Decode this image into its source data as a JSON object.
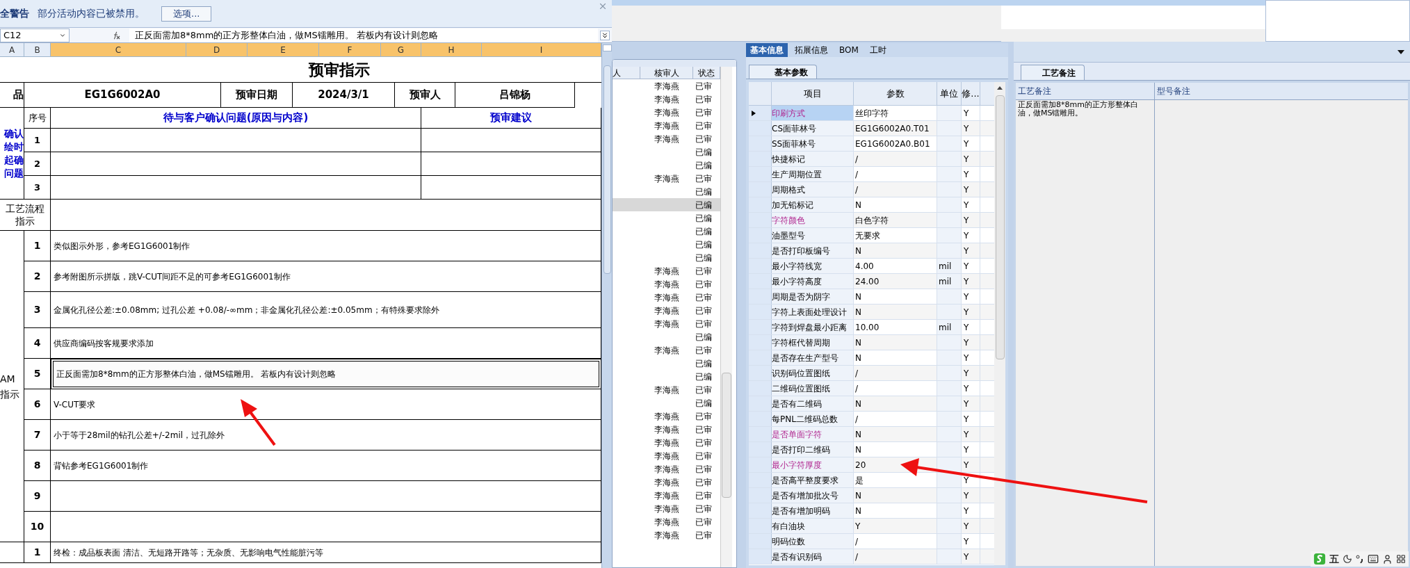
{
  "alert_bar": {
    "title": "全警告",
    "message": "部分活动内容已被禁用。",
    "button": "选项..."
  },
  "formula_bar": {
    "cell": "C12",
    "formula": "正反面需加8*8mm的正方形整体白油，做MS镭雕用。 若板内有设计则忽略"
  },
  "column_headers": [
    {
      "label": "A",
      "selected": false
    },
    {
      "label": "B",
      "selected": false
    },
    {
      "label": "C",
      "selected": true
    },
    {
      "label": "D",
      "selected": true
    },
    {
      "label": "E",
      "selected": true
    },
    {
      "label": "F",
      "selected": true
    },
    {
      "label": "G",
      "selected": true
    },
    {
      "label": "H",
      "selected": true
    },
    {
      "label": "I",
      "selected": true
    }
  ],
  "sheet": {
    "title": "预审指示",
    "product_label": "品",
    "product_code": "EG1G6002A0",
    "date_label": "预审日期",
    "date": "2024/3/1",
    "reviewer_label": "预审人",
    "reviewer": "吕锦杨",
    "confirm_section": {
      "label_lines": [
        "确认",
        "绘时",
        "起确",
        "问题"
      ],
      "number_header": "序号",
      "question_header": "待与客户确认问题(原因与内容)",
      "advice_header": "预审建议",
      "rows": [
        "1",
        "2",
        "3"
      ]
    },
    "process_label_lines": [
      "工艺流程",
      "指示"
    ],
    "cam_section": {
      "label_lines": [
        "AM",
        "指示"
      ],
      "rows": [
        {
          "number": "1",
          "text": "类似图示外形，参考EG1G6001制作",
          "selected": false
        },
        {
          "number": "2",
          "text": "参考附图所示拼版，跳V-CUT间距不足的可参考EG1G6001制作",
          "selected": false
        },
        {
          "number": "3",
          "text": "金属化孔径公差:±0.08mm; 过孔公差 +0.08/-∞mm；非金属化孔径公差:±0.05mm；有特殊要求除外",
          "selected": false
        },
        {
          "number": "4",
          "text": "供应商编码按客规要求添加",
          "selected": false
        },
        {
          "number": "5",
          "text": "正反面需加8*8mm的正方形整体白油，做MS镭雕用。 若板内有设计则忽略",
          "selected": true
        },
        {
          "number": "6",
          "text": "V-CUT要求",
          "selected": false
        },
        {
          "number": "7",
          "text": "小于等于28mil的钻孔公差+/-2mil，过孔除外",
          "selected": false
        },
        {
          "number": "8",
          "text": "背钻参考EG1G6001制作",
          "selected": false
        },
        {
          "number": "9",
          "selected": false
        },
        {
          "number": "10",
          "selected": false
        }
      ]
    },
    "final_row": {
      "number": "1",
      "text": "终检：成品板表面 清洁、无短路开路等；无杂质、无影响电气性能脏污等"
    }
  },
  "review_list": {
    "columns": [
      "人",
      "核审人",
      "状态"
    ],
    "rows": [
      {
        "reviewer": "李海燕",
        "status": "已审",
        "selected": false
      },
      {
        "reviewer": "李海燕",
        "status": "已审",
        "selected": false
      },
      {
        "reviewer": "李海燕",
        "status": "已审",
        "selected": false
      },
      {
        "reviewer": "李海燕",
        "status": "已审",
        "selected": false
      },
      {
        "reviewer": "李海燕",
        "status": "已审",
        "selected": false
      },
      {
        "status": "已编",
        "selected": false
      },
      {
        "status": "已编",
        "selected": false
      },
      {
        "reviewer": "李海燕",
        "status": "已审",
        "selected": false
      },
      {
        "status": "已编",
        "selected": false
      },
      {
        "status": "已编",
        "selected": true
      },
      {
        "status": "已编",
        "selected": false
      },
      {
        "status": "已编",
        "selected": false
      },
      {
        "status": "已编",
        "selected": false
      },
      {
        "status": "已编",
        "selected": false
      },
      {
        "reviewer": "李海燕",
        "status": "已审",
        "selected": false
      },
      {
        "reviewer": "李海燕",
        "status": "已审",
        "selected": false
      },
      {
        "reviewer": "李海燕",
        "status": "已审",
        "selected": false
      },
      {
        "reviewer": "李海燕",
        "status": "已审",
        "selected": false
      },
      {
        "reviewer": "李海燕",
        "status": "已审",
        "selected": false
      },
      {
        "status": "已编",
        "selected": false
      },
      {
        "reviewer": "李海燕",
        "status": "已审",
        "selected": false
      },
      {
        "status": "已编",
        "selected": false
      },
      {
        "status": "已编",
        "selected": false
      },
      {
        "reviewer": "李海燕",
        "status": "已审",
        "selected": false
      },
      {
        "status": "已编",
        "selected": false
      },
      {
        "reviewer": "李海燕",
        "status": "已审",
        "selected": false
      },
      {
        "reviewer": "李海燕",
        "status": "已审",
        "selected": false
      },
      {
        "reviewer": "李海燕",
        "status": "已审",
        "selected": false
      },
      {
        "reviewer": "李海燕",
        "status": "已审",
        "selected": false
      },
      {
        "reviewer": "李海燕",
        "status": "已审",
        "selected": false
      },
      {
        "reviewer": "李海燕",
        "status": "已审",
        "selected": false
      },
      {
        "reviewer": "李海燕",
        "status": "已审",
        "selected": false
      },
      {
        "reviewer": "李海燕",
        "status": "已审",
        "selected": false
      },
      {
        "reviewer": "李海燕",
        "status": "已审",
        "selected": false
      },
      {
        "reviewer": "李海燕",
        "status": "已审",
        "selected": false
      }
    ]
  },
  "info_panel": {
    "tabs": [
      {
        "label": "基本信息",
        "selected": true
      },
      {
        "label": "拓展信息",
        "selected": false
      },
      {
        "label": "BOM",
        "selected": false
      },
      {
        "label": "工时",
        "selected": false
      }
    ],
    "subtab": "基本参数",
    "columns": [
      "项目",
      "参数",
      "单位",
      "修..."
    ],
    "rows": [
      {
        "item": "印刷方式",
        "value": "丝印字符",
        "modify": "Y",
        "highlighted": true,
        "selected": true
      },
      {
        "item": "CS面菲林号",
        "value": "EG1G6002A0.T01",
        "modify": "Y",
        "highlighted": false,
        "selected": false
      },
      {
        "item": "SS面菲林号",
        "value": "EG1G6002A0.B01",
        "modify": "Y",
        "highlighted": false,
        "selected": false
      },
      {
        "item": "快捷标记",
        "value": "/",
        "modify": "Y",
        "highlighted": false,
        "selected": false
      },
      {
        "item": "生产周期位置",
        "value": "/",
        "modify": "Y",
        "highlighted": false,
        "selected": false
      },
      {
        "item": "周期格式",
        "value": "/",
        "modify": "Y",
        "highlighted": false,
        "selected": false
      },
      {
        "item": "加无铅标记",
        "value": "N",
        "modify": "Y",
        "highlighted": false,
        "selected": false
      },
      {
        "item": "字符颜色",
        "value": "白色字符",
        "modify": "Y",
        "highlighted": true,
        "selected": false
      },
      {
        "item": "油墨型号",
        "value": "无要求",
        "modify": "Y",
        "highlighted": false,
        "selected": false
      },
      {
        "item": "是否打印板编号",
        "value": "N",
        "modify": "Y",
        "highlighted": false,
        "selected": false
      },
      {
        "item": "最小字符线宽",
        "value": "4.00",
        "unit": "mil",
        "modify": "Y",
        "highlighted": false,
        "selected": false
      },
      {
        "item": "最小字符高度",
        "value": "24.00",
        "unit": "mil",
        "modify": "Y",
        "highlighted": false,
        "selected": false
      },
      {
        "item": "周期是否为阴字",
        "value": "N",
        "modify": "Y",
        "highlighted": false,
        "selected": false
      },
      {
        "item": "字符上表面处理设计",
        "value": "N",
        "modify": "Y",
        "highlighted": false,
        "selected": false
      },
      {
        "item": "字符到焊盘最小距离",
        "value": "10.00",
        "unit": "mil",
        "modify": "Y",
        "highlighted": false,
        "selected": false
      },
      {
        "item": "字符框代替周期",
        "value": "N",
        "modify": "Y",
        "highlighted": false,
        "selected": false
      },
      {
        "item": "是否存在生产型号",
        "value": "N",
        "modify": "Y",
        "highlighted": false,
        "selected": false
      },
      {
        "item": "识别码位置图纸",
        "value": "/",
        "modify": "Y",
        "highlighted": false,
        "selected": false
      },
      {
        "item": "二维码位置图纸",
        "value": "/",
        "modify": "Y",
        "highlighted": false,
        "selected": false
      },
      {
        "item": "是否有二维码",
        "value": "N",
        "modify": "Y",
        "highlighted": false,
        "selected": false
      },
      {
        "item": "每PNL二维码总数",
        "value": "/",
        "modify": "Y",
        "highlighted": false,
        "selected": false
      },
      {
        "item": "是否单面字符",
        "value": "N",
        "modify": "Y",
        "highlighted": true,
        "selected": false
      },
      {
        "item": "是否打印二维码",
        "value": "N",
        "modify": "Y",
        "highlighted": false,
        "selected": false
      },
      {
        "item": "最小字符厚度",
        "value": "20",
        "modify": "Y",
        "highlighted": true,
        "selected": false
      },
      {
        "item": "是否高平整度要求",
        "value": "是",
        "modify": "Y",
        "highlighted": false,
        "selected": false
      },
      {
        "item": "是否有增加批次号",
        "value": "N",
        "modify": "Y",
        "highlighted": false,
        "selected": false
      },
      {
        "item": "是否有增加明码",
        "value": "N",
        "modify": "Y",
        "highlighted": false,
        "selected": false
      },
      {
        "item": "有白油块",
        "value": "Y",
        "modify": "Y",
        "highlighted": false,
        "selected": false
      },
      {
        "item": "明码位数",
        "value": "/",
        "modify": "Y",
        "highlighted": false,
        "selected": false
      },
      {
        "item": "是否有识别码",
        "value": "/",
        "modify": "Y",
        "highlighted": false,
        "selected": false
      }
    ]
  },
  "notes_panel": {
    "tab": "工艺备注",
    "columns": [
      "工艺备注",
      "型号备注"
    ],
    "process_note": "正反面需加8*8mm的正方形整体白油，做MS镭雕用。"
  },
  "ime_toolbar": {
    "mode": "五"
  }
}
